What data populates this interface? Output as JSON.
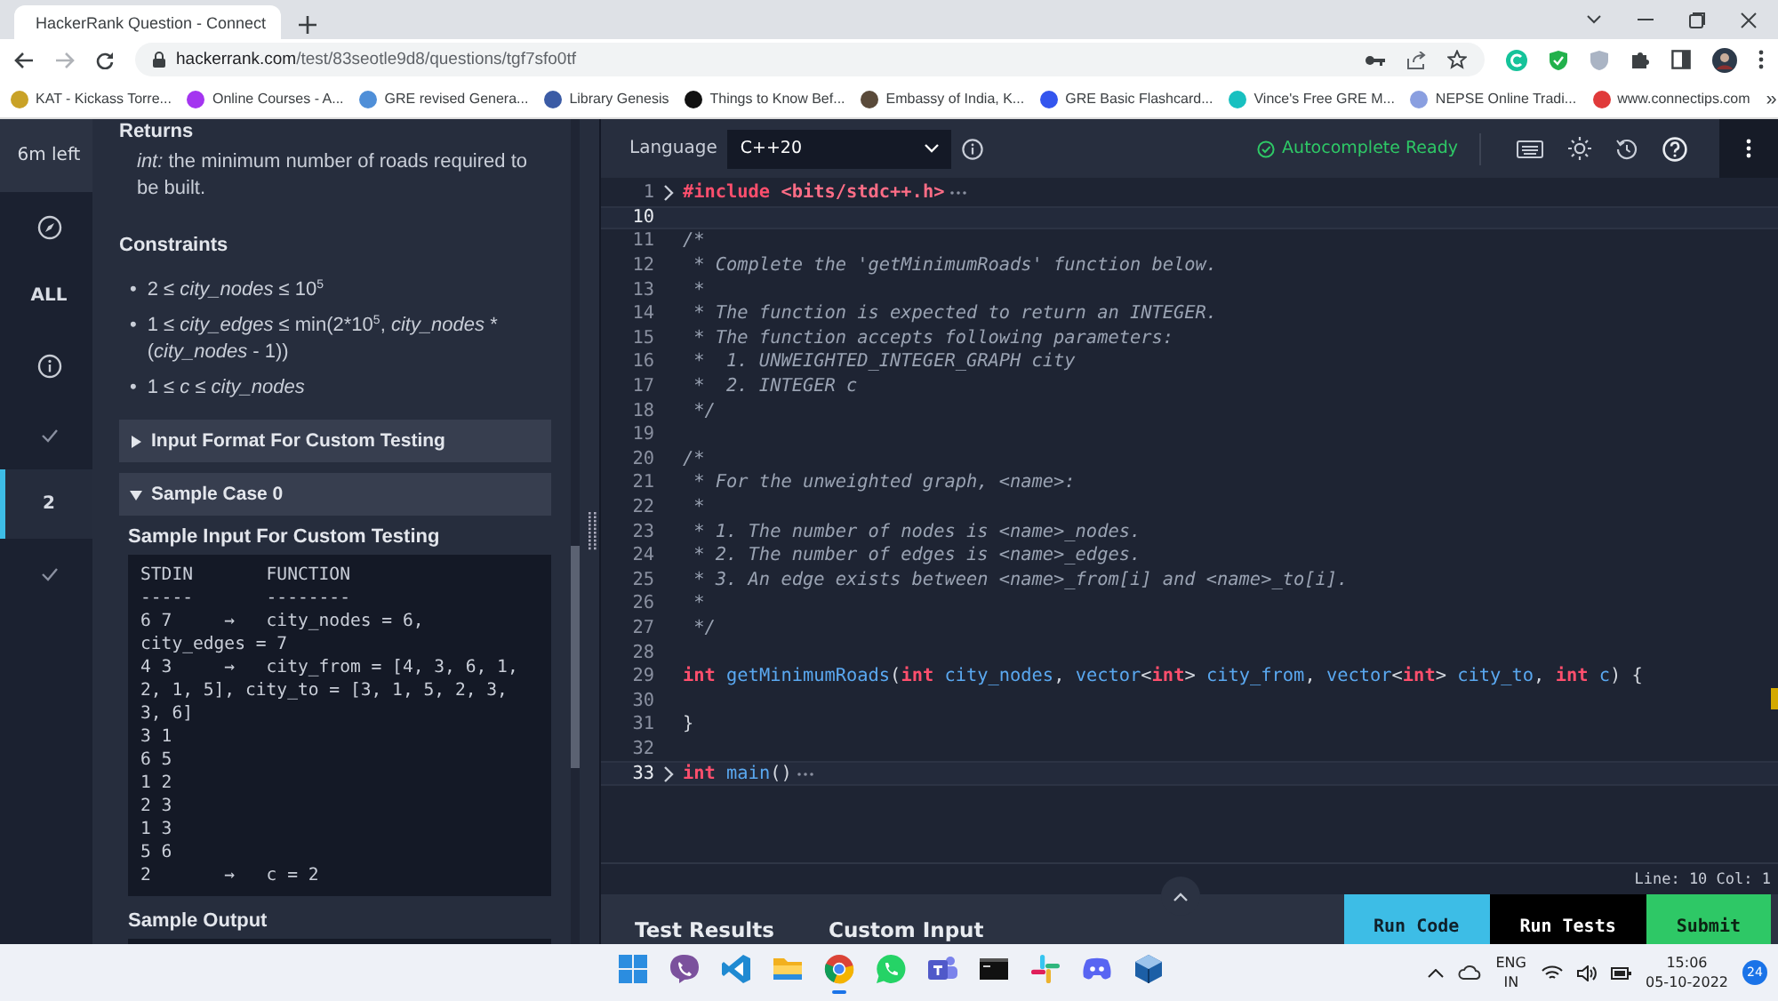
{
  "browser": {
    "tab": {
      "title": "HackerRank Question - Connect"
    },
    "url": {
      "domain": "hackerrank.com",
      "path": "/test/83seotle9d8/questions/tgf7sfo0tf"
    },
    "bookmarks": [
      {
        "label": "KAT - Kickass Torre...",
        "color": "#c9a227"
      },
      {
        "label": "Online Courses - A...",
        "color": "#a435f0"
      },
      {
        "label": "GRE revised Genera...",
        "color": "#4f8fd8"
      },
      {
        "label": "Library Genesis",
        "color": "#3b5ba5"
      },
      {
        "label": "Things to Know Bef...",
        "color": "#111111"
      },
      {
        "label": "Embassy of India, K...",
        "color": "#5a4a3a"
      },
      {
        "label": "GRE Basic Flashcard...",
        "color": "#3355ee"
      },
      {
        "label": "Vince's Free GRE M...",
        "color": "#18c0c0"
      },
      {
        "label": "NEPSE Online Tradi...",
        "color": "#8a9fe0"
      },
      {
        "label": "www.connectips.com",
        "color": "#e03a3a"
      }
    ],
    "more": "»"
  },
  "rail": [
    {
      "kind": "timer",
      "label": "6m left",
      "selected": false
    },
    {
      "kind": "compass",
      "selected": false
    },
    {
      "kind": "label",
      "label": "ALL",
      "selected": false
    },
    {
      "kind": "info",
      "selected": false
    },
    {
      "kind": "check",
      "selected": false
    },
    {
      "kind": "label",
      "label": "2",
      "selected": true
    },
    {
      "kind": "check",
      "selected": false
    }
  ],
  "description": {
    "returns": {
      "heading": "Returns",
      "text": [
        {
          "kind": "italic",
          "text": "int:"
        },
        {
          "kind": "plain",
          "text": " the minimum number of roads required to be built."
        }
      ]
    },
    "constraints": {
      "heading": "Constraints",
      "items": [
        {
          "bullet": "•",
          "segments": [
            {
              "kind": "plain",
              "text": "2 ≤ "
            },
            {
              "kind": "italic",
              "text": "city_nodes"
            },
            {
              "kind": "plain",
              "text": " ≤ 10"
            },
            {
              "kind": "sup",
              "text": "5"
            }
          ]
        },
        {
          "bullet": "•",
          "segments": [
            {
              "kind": "plain",
              "text": "1 ≤ "
            },
            {
              "kind": "italic",
              "text": "city_edges"
            },
            {
              "kind": "plain",
              "text": " ≤ min(2*10"
            },
            {
              "kind": "sup",
              "text": "5"
            },
            {
              "kind": "plain",
              "text": ", "
            },
            {
              "kind": "italic",
              "text": "city_nodes"
            },
            {
              "kind": "plain",
              "text": " * ("
            },
            {
              "kind": "italic",
              "text": "city_nodes"
            },
            {
              "kind": "plain",
              "text": " - 1))"
            }
          ]
        },
        {
          "bullet": "•",
          "segments": [
            {
              "kind": "plain",
              "text": "1 ≤ "
            },
            {
              "kind": "italic",
              "text": "c"
            },
            {
              "kind": "plain",
              "text": " ≤ "
            },
            {
              "kind": "italic",
              "text": "city_nodes"
            }
          ]
        }
      ]
    },
    "sections": [
      {
        "title": "Input Format For Custom Testing",
        "expanded": false
      },
      {
        "title": "Sample Case 0",
        "expanded": true
      }
    ],
    "sample_input": {
      "heading": "Sample Input For Custom Testing",
      "lines": [
        "STDIN       FUNCTION",
        "-----       --------",
        "6 7     →   city_nodes = 6, city_edges = 7",
        "4 3     →   city_from = [4, 3, 6, 1, 2, 1, 5], city_to = [3, 1, 5, 2, 3, 3, 6]",
        "3 1",
        "6 5",
        "1 2",
        "2 3",
        "1 3",
        "5 6",
        "2       →   c = 2"
      ]
    },
    "sample_output": {
      "heading": "Sample Output"
    }
  },
  "editor": {
    "language_label": "Language",
    "language": "C++20",
    "autocomplete": "Autocomplete Ready",
    "lines": [
      {
        "n": "1",
        "collapsed": true,
        "highlighted": false,
        "tokens": [
          {
            "kind": "keyword",
            "text": "#include"
          },
          {
            "kind": "string",
            "text": " <bits/stdc++.h>"
          }
        ]
      },
      {
        "n": "10",
        "collapsed": false,
        "highlighted": true
      },
      {
        "n": "11",
        "collapsed": false,
        "highlighted": false,
        "tokens": [
          {
            "kind": "comment",
            "text": "/*"
          }
        ]
      },
      {
        "n": "12",
        "collapsed": false,
        "highlighted": false,
        "tokens": [
          {
            "kind": "comment",
            "text": " * Complete the 'getMinimumRoads' function below."
          }
        ]
      },
      {
        "n": "13",
        "collapsed": false,
        "highlighted": false,
        "tokens": [
          {
            "kind": "comment",
            "text": " *"
          }
        ]
      },
      {
        "n": "14",
        "collapsed": false,
        "highlighted": false,
        "tokens": [
          {
            "kind": "comment",
            "text": " * The function is expected to return an INTEGER."
          }
        ]
      },
      {
        "n": "15",
        "collapsed": false,
        "highlighted": false,
        "tokens": [
          {
            "kind": "comment",
            "text": " * The function accepts following parameters:"
          }
        ]
      },
      {
        "n": "16",
        "collapsed": false,
        "highlighted": false,
        "tokens": [
          {
            "kind": "comment",
            "text": " *  1. UNWEIGHTED_INTEGER_GRAPH city"
          }
        ]
      },
      {
        "n": "17",
        "collapsed": false,
        "highlighted": false,
        "tokens": [
          {
            "kind": "comment",
            "text": " *  2. INTEGER c"
          }
        ]
      },
      {
        "n": "18",
        "collapsed": false,
        "highlighted": false,
        "tokens": [
          {
            "kind": "comment",
            "text": " */"
          }
        ]
      },
      {
        "n": "19",
        "collapsed": false,
        "highlighted": false
      },
      {
        "n": "20",
        "collapsed": false,
        "highlighted": false,
        "tokens": [
          {
            "kind": "comment",
            "text": "/*"
          }
        ]
      },
      {
        "n": "21",
        "collapsed": false,
        "highlighted": false,
        "tokens": [
          {
            "kind": "comment",
            "text": " * For the unweighted graph, <name>:"
          }
        ]
      },
      {
        "n": "22",
        "collapsed": false,
        "highlighted": false,
        "tokens": [
          {
            "kind": "comment",
            "text": " *"
          }
        ]
      },
      {
        "n": "23",
        "collapsed": false,
        "highlighted": false,
        "tokens": [
          {
            "kind": "comment",
            "text": " * 1. The number of nodes is <name>_nodes."
          }
        ]
      },
      {
        "n": "24",
        "collapsed": false,
        "highlighted": false,
        "tokens": [
          {
            "kind": "comment",
            "text": " * 2. The number of edges is <name>_edges."
          }
        ]
      },
      {
        "n": "25",
        "collapsed": false,
        "highlighted": false,
        "tokens": [
          {
            "kind": "comment",
            "text": " * 3. An edge exists between <name>_from[i] and <name>_to[i]."
          }
        ]
      },
      {
        "n": "26",
        "collapsed": false,
        "highlighted": false,
        "tokens": [
          {
            "kind": "comment",
            "text": " *"
          }
        ]
      },
      {
        "n": "27",
        "collapsed": false,
        "highlighted": false,
        "tokens": [
          {
            "kind": "comment",
            "text": " */"
          }
        ]
      },
      {
        "n": "28",
        "collapsed": false,
        "highlighted": false
      },
      {
        "n": "29",
        "collapsed": false,
        "highlighted": false,
        "tokens": [
          {
            "kind": "keyword",
            "text": "int"
          },
          {
            "kind": "ident",
            "text": " getMinimumRoads"
          },
          {
            "kind": "plain",
            "text": "("
          },
          {
            "kind": "keyword",
            "text": "int"
          },
          {
            "kind": "ident",
            "text": " city_nodes"
          },
          {
            "kind": "plain",
            "text": ", "
          },
          {
            "kind": "ident",
            "text": "vector"
          },
          {
            "kind": "plain",
            "text": "<"
          },
          {
            "kind": "keyword",
            "text": "int"
          },
          {
            "kind": "plain",
            "text": "> "
          },
          {
            "kind": "ident",
            "text": "city_from"
          },
          {
            "kind": "plain",
            "text": ", "
          },
          {
            "kind": "ident",
            "text": "vector"
          },
          {
            "kind": "plain",
            "text": "<"
          },
          {
            "kind": "keyword",
            "text": "int"
          },
          {
            "kind": "plain",
            "text": "> "
          },
          {
            "kind": "ident",
            "text": "city_to"
          },
          {
            "kind": "plain",
            "text": ", "
          },
          {
            "kind": "keyword",
            "text": "int"
          },
          {
            "kind": "ident",
            "text": " c"
          },
          {
            "kind": "plain",
            "text": ") {"
          }
        ]
      },
      {
        "n": "30",
        "collapsed": false,
        "highlighted": false
      },
      {
        "n": "31",
        "collapsed": false,
        "highlighted": false,
        "tokens": [
          {
            "kind": "plain",
            "text": "}"
          }
        ]
      },
      {
        "n": "32",
        "collapsed": false,
        "highlighted": false
      },
      {
        "n": "33",
        "collapsed": true,
        "highlighted": true,
        "tokens": [
          {
            "kind": "keyword",
            "text": "int"
          },
          {
            "kind": "ident",
            "text": " main"
          },
          {
            "kind": "plain",
            "text": "()"
          }
        ]
      }
    ],
    "status": "Line: 10 Col: 1",
    "bottom_tabs": [
      "Test Results",
      "Custom Input"
    ],
    "actions": [
      {
        "kind": "run",
        "label": "Run Code"
      },
      {
        "kind": "tests",
        "label": "Run Tests"
      },
      {
        "kind": "submit",
        "label": "Submit"
      }
    ]
  },
  "taskbar": {
    "apps": [
      {
        "kind": "start",
        "selected": false
      },
      {
        "kind": "viber",
        "selected": false
      },
      {
        "kind": "vscode",
        "selected": false
      },
      {
        "kind": "files",
        "selected": false
      },
      {
        "kind": "chrome",
        "selected": true
      },
      {
        "kind": "whatsapp",
        "selected": false
      },
      {
        "kind": "teams",
        "selected": false
      },
      {
        "kind": "terminal",
        "selected": false
      },
      {
        "kind": "slack",
        "selected": false
      },
      {
        "kind": "discord",
        "selected": false
      },
      {
        "kind": "box",
        "selected": false
      }
    ],
    "language": "ENG",
    "region": "IN",
    "time": "15:06",
    "date": "05-10-2022",
    "notifications": "24"
  }
}
